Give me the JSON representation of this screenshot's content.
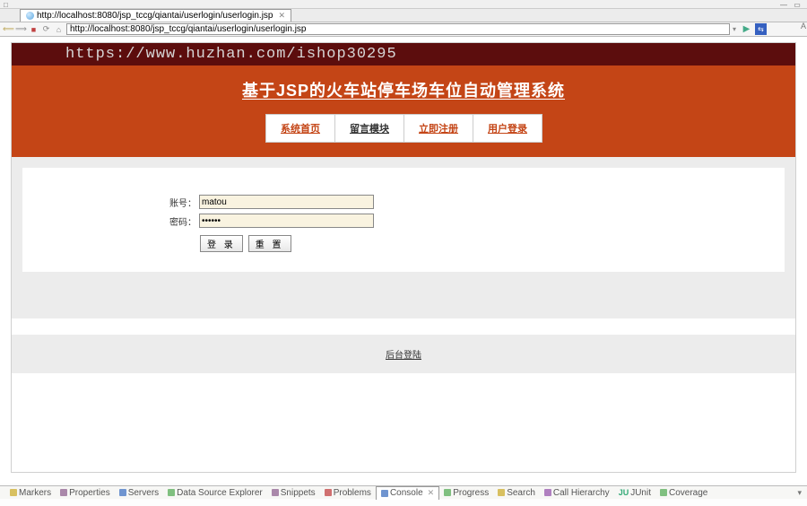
{
  "window": {
    "left_icon_hint": "□"
  },
  "tab": {
    "title": "http://localhost:8080/jsp_tccg/qiantai/userlogin/userlogin.jsp",
    "close": "✕"
  },
  "address": {
    "url": "http://localhost:8080/jsp_tccg/qiantai/userlogin/userlogin.jsp"
  },
  "page": {
    "watermark_url": "https://www.huzhan.com/ishop30295",
    "title": "基于JSP的火车站停车场车位自动管理系统",
    "nav": {
      "home": "系统首页",
      "messages": "留言模块",
      "register": "立即注册",
      "login": "用户登录"
    },
    "form": {
      "username_label": "账号：",
      "username_value": "matou",
      "password_label": "密码：",
      "password_value": "••••••",
      "btn_login": "登 录",
      "btn_reset": "重 置"
    },
    "footer_link": "后台登陆"
  },
  "bottom_panel": {
    "tabs": {
      "markers": "Markers",
      "properties": "Properties",
      "servers": "Servers",
      "dse": "Data Source Explorer",
      "snippets": "Snippets",
      "problems": "Problems",
      "console": "Console",
      "progress": "Progress",
      "search": "Search",
      "call_hierarchy": "Call Hierarchy",
      "junit": "JUnit",
      "coverage": "Coverage"
    },
    "console_badge": "✕"
  },
  "right_label": "A"
}
